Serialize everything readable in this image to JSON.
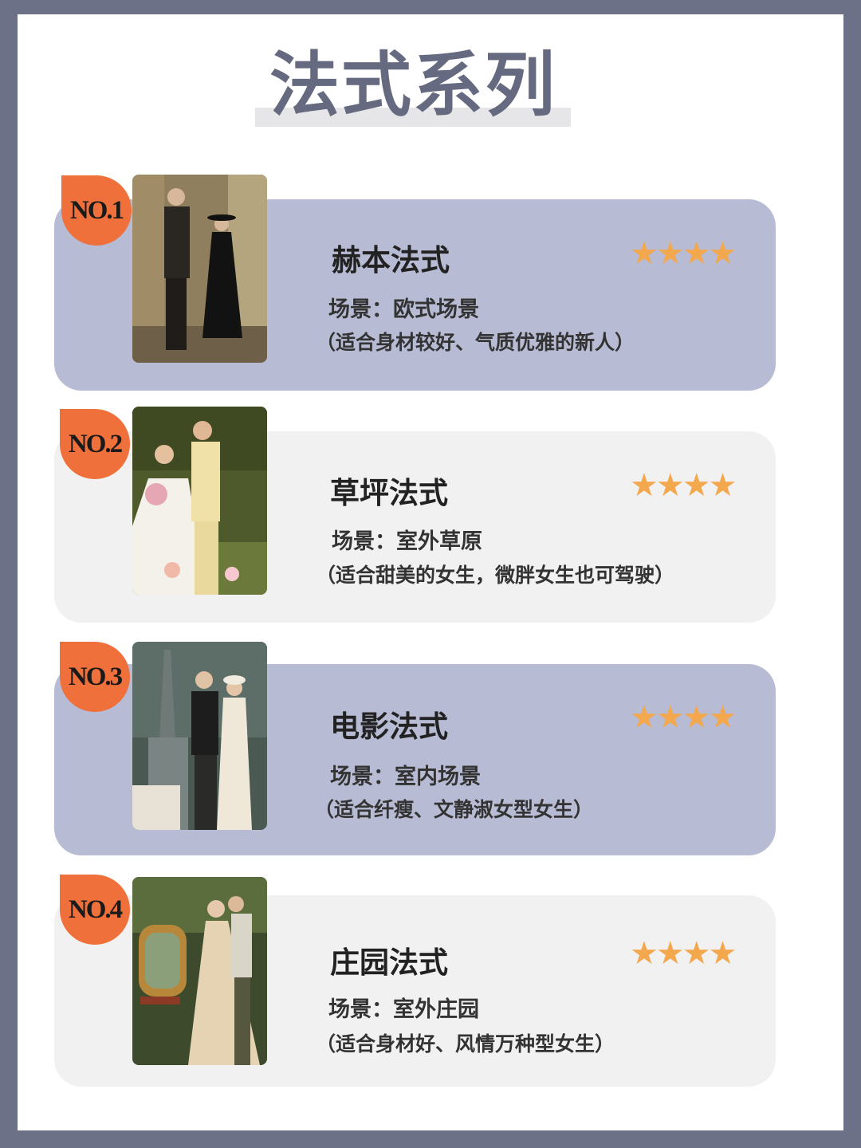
{
  "page": {
    "title": "法式系列",
    "colors": {
      "frame": "#6c7187",
      "accent": "#f0703b",
      "card_dark": "#b7bbd3",
      "card_light": "#f1f1f1",
      "star": "#f3a84e"
    }
  },
  "items": [
    {
      "rank": "NO.1",
      "name": "赫本法式",
      "rating": 4,
      "stars": "★★★★",
      "scene": "场景：欧式场景",
      "fit": "（适合身材较好、气质优雅的新人）",
      "photo": "couple-portrait-photo"
    },
    {
      "rank": "NO.2",
      "name": "草坪法式",
      "rating": 4,
      "stars": "★★★★",
      "scene": "场景：室外草原",
      "fit": "（适合甜美的女生，微胖女生也可驾驶）",
      "photo": "couple-violin-photo"
    },
    {
      "rank": "NO.3",
      "name": "电影法式",
      "rating": 4,
      "stars": "★★★★",
      "scene": "场景：室内场景",
      "fit": "（适合纤瘦、文静淑女型女生）",
      "photo": "couple-cathedral-photo"
    },
    {
      "rank": "NO.4",
      "name": "庄园法式",
      "rating": 4,
      "stars": "★★★★",
      "scene": "场景：室外庄园",
      "fit": "（适合身材好、风情万种型女生）",
      "photo": "couple-garden-photo"
    }
  ]
}
